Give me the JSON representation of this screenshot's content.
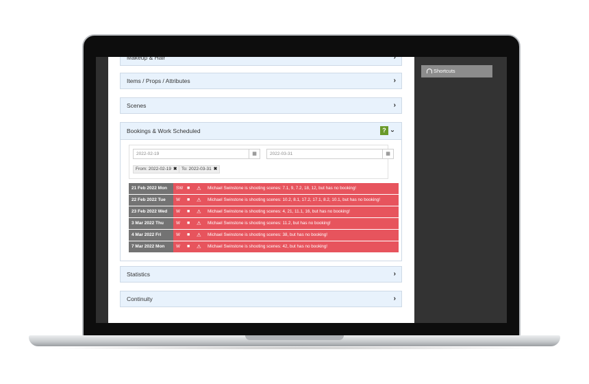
{
  "sidebar": {
    "shortcuts_label": "Shortcuts"
  },
  "panels": {
    "makeup_hair": "Makeup & Hair",
    "items": "Items / Props / Attributes",
    "scenes": "Scenes",
    "bookings": "Bookings & Work Scheduled",
    "statistics": "Statistics",
    "continuity": "Continuity"
  },
  "filters": {
    "from_date": "2022-02-19",
    "to_date": "2022-03-31",
    "from_tag": "From: 2022-02-19",
    "to_tag": "To: 2022-03-31"
  },
  "icons": {
    "chevron": "›",
    "calendar": "▦",
    "camera": "■",
    "warning": "⚠",
    "help": "?",
    "remove": "✖"
  },
  "colors": {
    "alert_row": "#e7545d",
    "date_cell": "#737373",
    "panel_bg": "#e8f2fc",
    "help_btn": "#6a9a2a"
  },
  "bookings": [
    {
      "date": "21 Feb 2022 Mon",
      "code": "SW",
      "message": "Michael Swinstone is shooting scenes: 7.1, 9, 7.2, 18, 12, but has no booking!"
    },
    {
      "date": "22 Feb 2022 Tue",
      "code": "W",
      "message": "Michael Swinstone is shooting scenes: 10.2, 8.1, 17.2, 17.1, 8.2, 10.1, but has no booking!"
    },
    {
      "date": "23 Feb 2022 Wed",
      "code": "W",
      "message": "Michael Swinstone is shooting scenes: 4, 21, 11.1, 16, but has no booking!"
    },
    {
      "date": "3 Mar 2022 Thu",
      "code": "W",
      "message": "Michael Swinstone is shooting scenes: 11.2, but has no booking!"
    },
    {
      "date": "4 Mar 2022 Fri",
      "code": "W",
      "message": "Michael Swinstone is shooting scenes: 38, but has no booking!"
    },
    {
      "date": "7 Mar 2022 Mon",
      "code": "W",
      "message": "Michael Swinstone is shooting scenes: 42, but has no booking!"
    }
  ]
}
